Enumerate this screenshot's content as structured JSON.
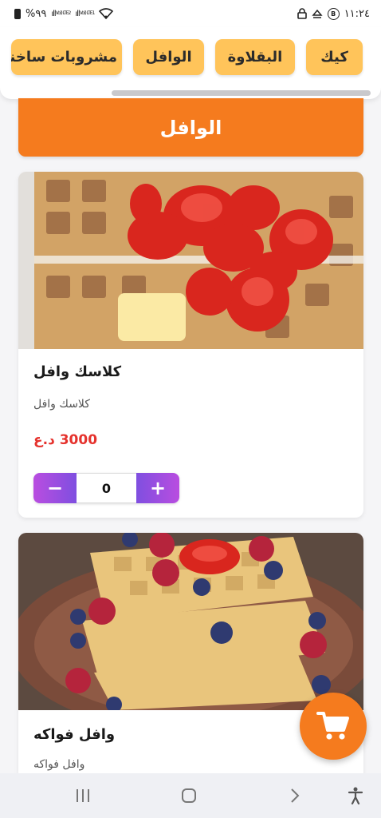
{
  "status_bar": {
    "time": "١١:٢٤",
    "battery": "%٩٩",
    "signal_labels": [
      "Vo)) LTE2",
      "Vo)) LTE1"
    ],
    "b_badge": "B"
  },
  "categories": [
    {
      "label": "كيك",
      "selected": false
    },
    {
      "label": "البقلاوة",
      "selected": false
    },
    {
      "label": "الوافل",
      "selected": true
    },
    {
      "label": "مشروبات ساخنة",
      "selected": false
    }
  ],
  "section": {
    "title": "الوافل"
  },
  "products": [
    {
      "name": "كلاسك وافل",
      "description": "كلاسك وافل",
      "price": "3000 د.ع",
      "quantity": "0"
    },
    {
      "name": "وافل فواكه",
      "description": "وافل فواكه"
    }
  ],
  "stepper": {
    "minus": "−",
    "plus": "+"
  },
  "colors": {
    "primary_orange": "#f57b1e",
    "category_yellow": "#ffc45a",
    "price_red": "#e5322d",
    "stepper_purple": "#9b4fe0"
  },
  "icons": {
    "cart": "shopping-cart-icon",
    "nav": [
      "recent-apps-icon",
      "home-icon",
      "back-icon",
      "accessibility-icon"
    ]
  }
}
